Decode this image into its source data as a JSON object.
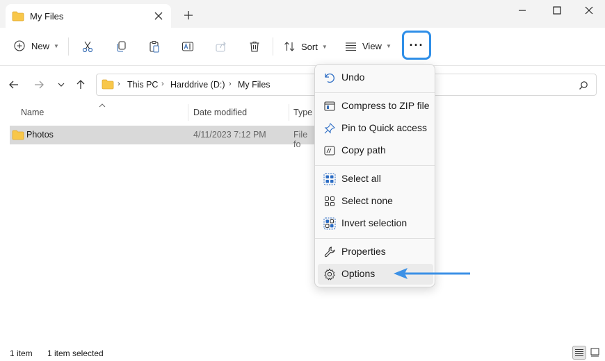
{
  "tab": {
    "title": "My Files"
  },
  "toolbar": {
    "new_label": "New",
    "sort_label": "Sort",
    "view_label": "View",
    "more_label": "···"
  },
  "address": {
    "crumbs": [
      "This PC",
      "Harddrive (D:)",
      "My Files"
    ]
  },
  "columns": {
    "name": "Name",
    "date_modified": "Date modified",
    "type": "Type"
  },
  "files": [
    {
      "name": "Photos",
      "date": "4/11/2023 7:12 PM",
      "type": "File fo"
    }
  ],
  "menu": {
    "items": [
      {
        "label": "Undo",
        "icon": "undo-icon"
      },
      {
        "label": "Compress to ZIP file",
        "icon": "zip-icon"
      },
      {
        "label": "Pin to Quick access",
        "icon": "pin-icon"
      },
      {
        "label": "Copy path",
        "icon": "copy-path-icon"
      },
      {
        "label": "Select all",
        "icon": "select-all-icon"
      },
      {
        "label": "Select none",
        "icon": "select-none-icon"
      },
      {
        "label": "Invert selection",
        "icon": "invert-selection-icon"
      },
      {
        "label": "Properties",
        "icon": "wrench-icon"
      },
      {
        "label": "Options",
        "icon": "gear-icon"
      }
    ]
  },
  "status": {
    "count": "1 item",
    "selected": "1 item selected"
  },
  "colors": {
    "accent": "#2f8fe8",
    "folder": "#f8c74a",
    "selected_row": "#d9d9d9",
    "annotation_arrow": "#3c91e6"
  }
}
